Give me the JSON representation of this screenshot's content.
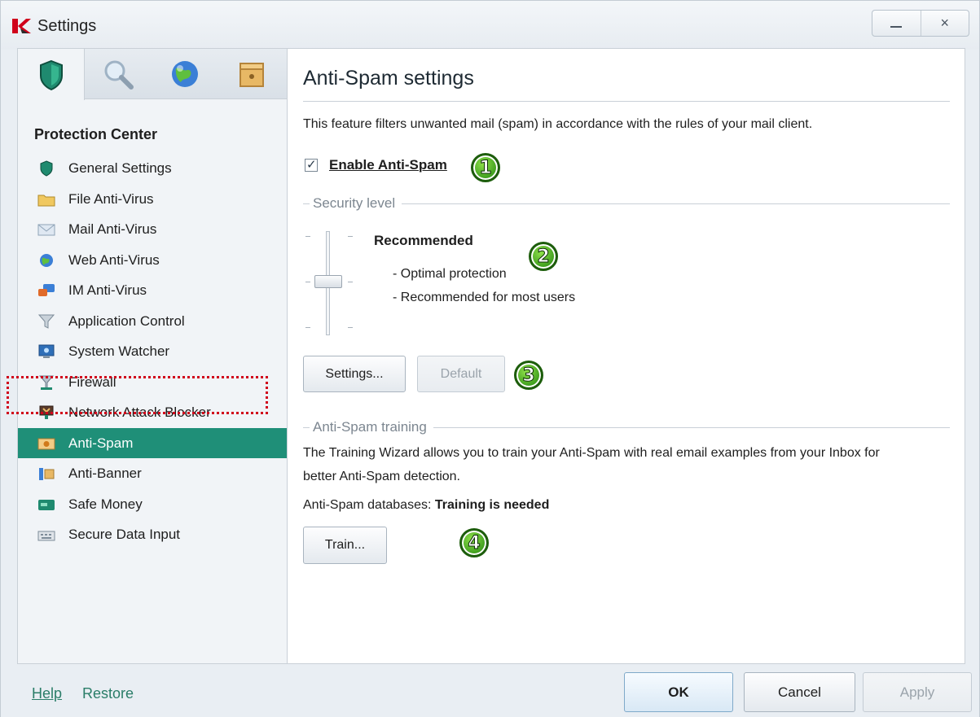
{
  "window": {
    "title": "Settings",
    "minimize_icon": "minimize-icon",
    "close_icon": "close-icon",
    "close_glyph": "×"
  },
  "tabs": [
    {
      "name": "protection",
      "icon": "shield-icon"
    },
    {
      "name": "scan",
      "icon": "magnifier-icon"
    },
    {
      "name": "update",
      "icon": "globe-icon"
    },
    {
      "name": "advanced",
      "icon": "box-icon"
    }
  ],
  "sidebar": {
    "section_title": "Protection Center",
    "items": [
      {
        "label": "General Settings",
        "icon": "shield-icon"
      },
      {
        "label": "File Anti-Virus",
        "icon": "folder-icon"
      },
      {
        "label": "Mail Anti-Virus",
        "icon": "envelope-icon"
      },
      {
        "label": "Web Anti-Virus",
        "icon": "globe-icon"
      },
      {
        "label": "IM Anti-Virus",
        "icon": "chat-icon"
      },
      {
        "label": "Application Control",
        "icon": "funnel-icon"
      },
      {
        "label": "System Watcher",
        "icon": "monitor-icon"
      },
      {
        "label": "Firewall",
        "icon": "firewall-icon"
      },
      {
        "label": "Network Attack Blocker",
        "icon": "network-icon"
      },
      {
        "label": "Anti-Spam",
        "icon": "spam-icon",
        "selected": true
      },
      {
        "label": "Anti-Banner",
        "icon": "banner-icon"
      },
      {
        "label": "Safe Money",
        "icon": "money-icon"
      },
      {
        "label": "Secure Data Input",
        "icon": "keyboard-icon"
      }
    ]
  },
  "main": {
    "title": "Anti-Spam settings",
    "description": "This feature filters unwanted mail (spam) in accordance with the rules of your mail client.",
    "enable_checkbox": {
      "label": "Enable Anti-Spam",
      "checked": true
    },
    "security_level": {
      "header": "Security level",
      "level_name": "Recommended",
      "details": [
        "- Optimal protection",
        "- Recommended for most users"
      ],
      "slider_position": "middle of 3 levels"
    },
    "buttons": {
      "settings": "Settings...",
      "default": "Default"
    },
    "training": {
      "header": "Anti-Spam training",
      "text_line1": "The Training Wizard allows you to train your Anti-Spam with real email examples from your Inbox for",
      "text_line2": "better Anti-Spam detection.",
      "db_label": "Anti-Spam databases:",
      "db_status": "Training is needed",
      "train_button": "Train..."
    },
    "callouts": [
      "1",
      "2",
      "3",
      "4"
    ],
    "callout_color": "#3b9b1c"
  },
  "footer": {
    "help": "Help",
    "restore": "Restore",
    "ok": "OK",
    "cancel": "Cancel",
    "apply": "Apply"
  },
  "colors": {
    "accent": "#1f8f78",
    "highlight_outline": "#d0021b",
    "link": "#2a7d68"
  }
}
